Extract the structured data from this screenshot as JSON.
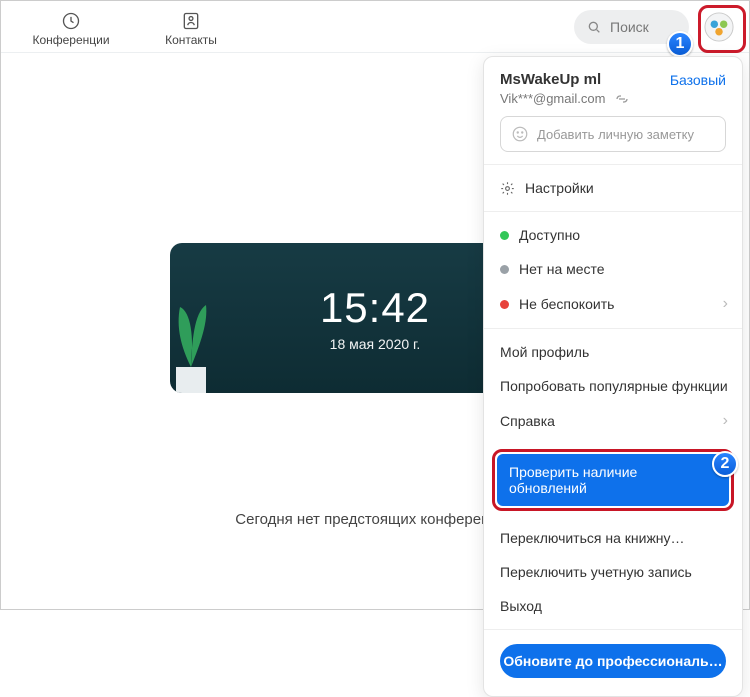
{
  "topbar": {
    "tabs": [
      {
        "label": "Конференции"
      },
      {
        "label": "Контакты"
      }
    ],
    "search_placeholder": "Поиск"
  },
  "hero": {
    "time": "15:42",
    "date": "18 мая 2020 г.",
    "empty_message": "Сегодня нет предстоящих конференций"
  },
  "profile": {
    "name": "MsWakeUp ml",
    "plan": "Базовый",
    "email": "Vik***@gmail.com",
    "note_placeholder": "Добавить личную заметку",
    "settings_label": "Настройки",
    "status": {
      "available": "Доступно",
      "away": "Нет на месте",
      "dnd": "Не беспокоить"
    },
    "menu": {
      "profile": "Мой профиль",
      "try_features": "Попробовать популярные функции",
      "help": "Справка",
      "check_updates": "Проверить наличие обновлений",
      "switch_view": "Переключиться на книжну…",
      "switch_account": "Переключить учетную запись",
      "logout": "Выход"
    },
    "upgrade_label": "Обновите до профессиональ…"
  },
  "annotations": {
    "step1": "1",
    "step2": "2"
  }
}
